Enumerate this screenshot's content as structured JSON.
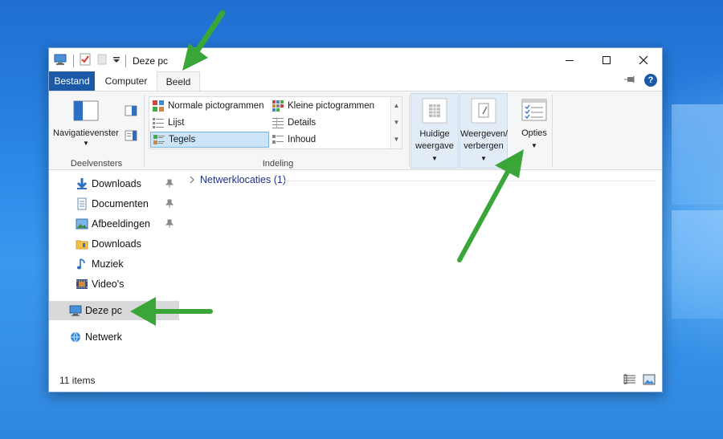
{
  "window": {
    "title": "Deze pc"
  },
  "tabs": {
    "file": "Bestand",
    "computer": "Computer",
    "view": "Beeld"
  },
  "ribbon": {
    "panes": {
      "navigation_pane": "Navigatievenster",
      "group_label": "Deelvensters"
    },
    "layout": {
      "items": [
        "Normale pictogrammen",
        "Kleine pictogrammen",
        "Lijst",
        "Details",
        "Tegels",
        "Inhoud"
      ],
      "group_label": "Indeling",
      "selected": "Tegels"
    },
    "current_view": {
      "line1": "Huidige",
      "line2": "weergave"
    },
    "show_hide": {
      "line1": "Weergeven/",
      "line2": "verbergen"
    },
    "options": "Opties"
  },
  "nav": {
    "items": [
      {
        "label": "Downloads",
        "icon": "download-arrow-icon",
        "pinned": true
      },
      {
        "label": "Documenten",
        "icon": "document-icon",
        "pinned": true
      },
      {
        "label": "Afbeeldingen",
        "icon": "pictures-icon",
        "pinned": true
      },
      {
        "label": "Downloads",
        "icon": "folder-icon",
        "pinned": false
      },
      {
        "label": "Muziek",
        "icon": "music-note-icon",
        "pinned": false
      },
      {
        "label": "Video's",
        "icon": "video-icon",
        "pinned": false
      }
    ],
    "this_pc": "Deze pc",
    "network": "Netwerk"
  },
  "content": {
    "group_header": "Netwerklocaties (1)"
  },
  "status": {
    "items": "11 items"
  },
  "colors": {
    "accent": "#1c5aa8",
    "arrow": "#3aa63a",
    "selection": "#cce4f7",
    "group_text": "#1e3287"
  }
}
